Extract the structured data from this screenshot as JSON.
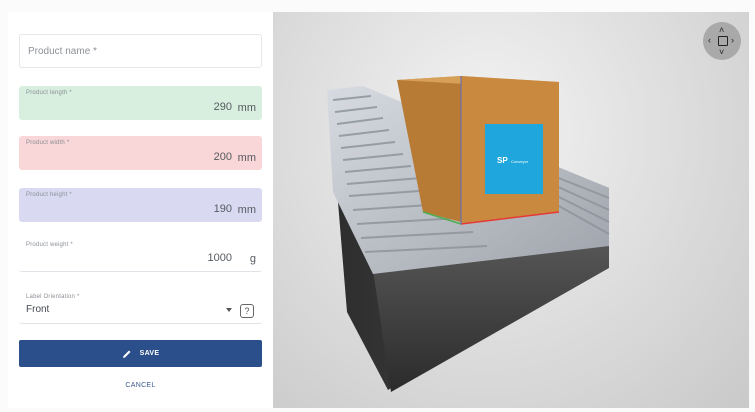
{
  "form": {
    "name": {
      "placeholder": "Product name *"
    },
    "length": {
      "label": "Product length *",
      "value": "290",
      "unit": "mm"
    },
    "width": {
      "label": "Product width *",
      "value": "200",
      "unit": "mm"
    },
    "height": {
      "label": "Product height *",
      "value": "190",
      "unit": "mm"
    },
    "weight": {
      "label": "Product weight *",
      "value": "1000",
      "unit": "g"
    },
    "orientation": {
      "label": "Label Orientation *",
      "value": "Front",
      "help": "?"
    }
  },
  "actions": {
    "save_label": "SAVE",
    "cancel_label": "CANCEL"
  },
  "viewport": {
    "box_logo_text": "SP",
    "box_logo_subtext": "Conveyor",
    "nav": {
      "up": "˄",
      "down": "˅",
      "left": "‹",
      "right": "›"
    }
  },
  "colors": {
    "save_button": "#2b4f8a",
    "length_field": "#d8efdf",
    "width_field": "#f9d6d7",
    "height_field": "#d9daf1",
    "box_cardboard": "#c9893f",
    "label_blue": "#1ea6dd"
  }
}
